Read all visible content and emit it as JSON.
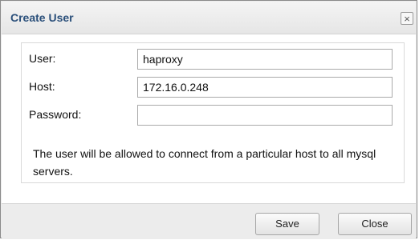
{
  "dialog": {
    "title": "Create User",
    "close_icon": "close-icon"
  },
  "form": {
    "user_label": "User:",
    "user_value": "haproxy",
    "host_label": "Host:",
    "host_value": "172.16.0.248",
    "password_label": "Password:",
    "password_value": "",
    "note": "The user will be allowed to connect from a particular host to all mysql servers."
  },
  "buttons": {
    "save_label": "Save",
    "close_label": "Close"
  }
}
